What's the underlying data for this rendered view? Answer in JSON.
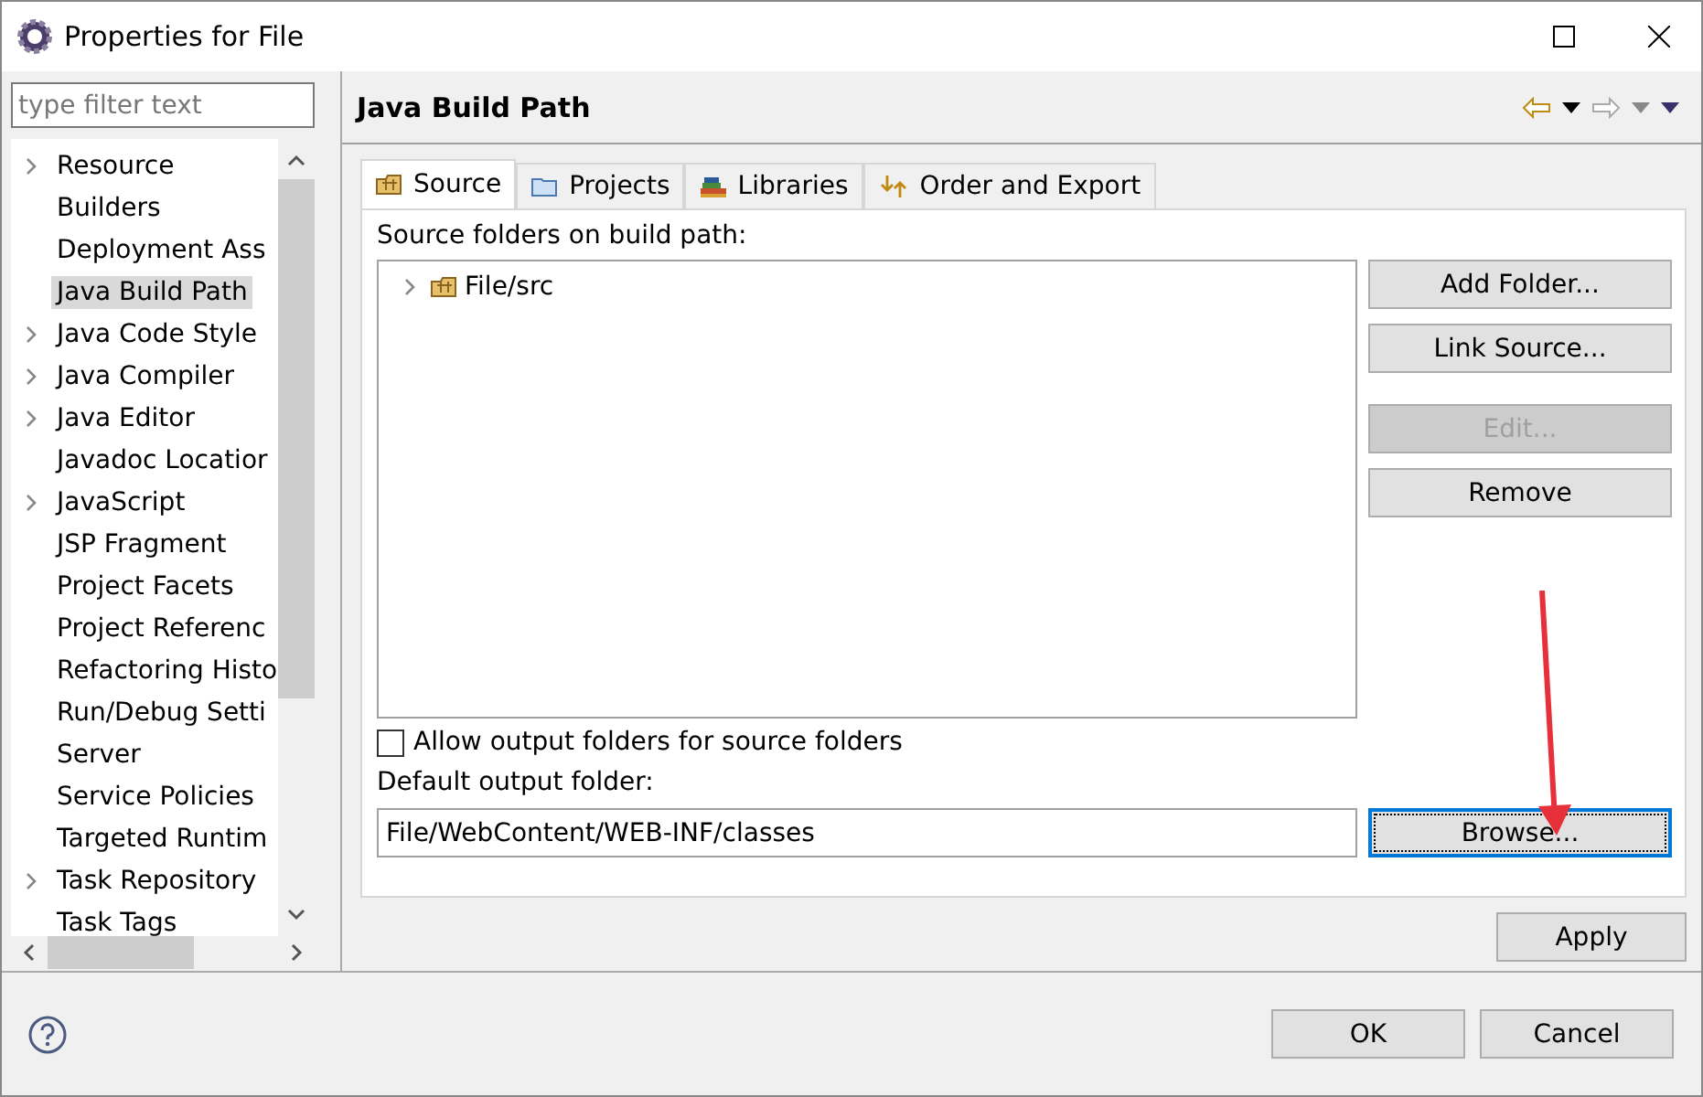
{
  "window": {
    "title": "Properties for File"
  },
  "filter": {
    "placeholder": "type filter text"
  },
  "sidebar": {
    "items": [
      {
        "label": "Resource",
        "expandable": true,
        "selected": false
      },
      {
        "label": "Builders",
        "expandable": false,
        "selected": false
      },
      {
        "label": "Deployment Ass",
        "expandable": false,
        "selected": false
      },
      {
        "label": "Java Build Path",
        "expandable": false,
        "selected": true
      },
      {
        "label": "Java Code Style",
        "expandable": true,
        "selected": false
      },
      {
        "label": "Java Compiler",
        "expandable": true,
        "selected": false
      },
      {
        "label": "Java Editor",
        "expandable": true,
        "selected": false
      },
      {
        "label": "Javadoc Locatior",
        "expandable": false,
        "selected": false
      },
      {
        "label": "JavaScript",
        "expandable": true,
        "selected": false
      },
      {
        "label": "JSP Fragment",
        "expandable": false,
        "selected": false
      },
      {
        "label": "Project Facets",
        "expandable": false,
        "selected": false
      },
      {
        "label": "Project Referenc",
        "expandable": false,
        "selected": false
      },
      {
        "label": "Refactoring Histo",
        "expandable": false,
        "selected": false
      },
      {
        "label": "Run/Debug Setti",
        "expandable": false,
        "selected": false
      },
      {
        "label": "Server",
        "expandable": false,
        "selected": false
      },
      {
        "label": "Service Policies",
        "expandable": false,
        "selected": false
      },
      {
        "label": "Targeted Runtim",
        "expandable": false,
        "selected": false
      },
      {
        "label": "Task Repository",
        "expandable": true,
        "selected": false
      },
      {
        "label": "Task Tags",
        "expandable": false,
        "selected": false
      }
    ]
  },
  "page": {
    "title": "Java Build Path",
    "tabs": [
      {
        "label": "Source",
        "kind": "source",
        "selected": true
      },
      {
        "label": "Projects",
        "kind": "projects",
        "selected": false
      },
      {
        "label": "Libraries",
        "kind": "libraries",
        "selected": false
      },
      {
        "label": "Order and Export",
        "kind": "order",
        "selected": false
      }
    ],
    "list_label": "Source folders on build path:",
    "folders": [
      {
        "label": "File/src",
        "expanded": false
      }
    ],
    "side_button_groups": [
      {
        "buttons": [
          {
            "label": "Add Folder...",
            "disabled": false
          },
          {
            "label": "Link Source...",
            "disabled": false
          }
        ]
      },
      {
        "buttons": [
          {
            "label": "Edit...",
            "disabled": true
          },
          {
            "label": "Remove",
            "disabled": false
          }
        ]
      }
    ],
    "allow_output": {
      "label": "Allow output folders for source folders",
      "checked": false
    },
    "output_label": "Default output folder:",
    "output_value": "File/WebContent/WEB-INF/classes",
    "browse": {
      "label": "Browse...",
      "focused": true
    },
    "apply": "Apply"
  },
  "footer": {
    "buttons": [
      "OK",
      "Cancel"
    ]
  }
}
